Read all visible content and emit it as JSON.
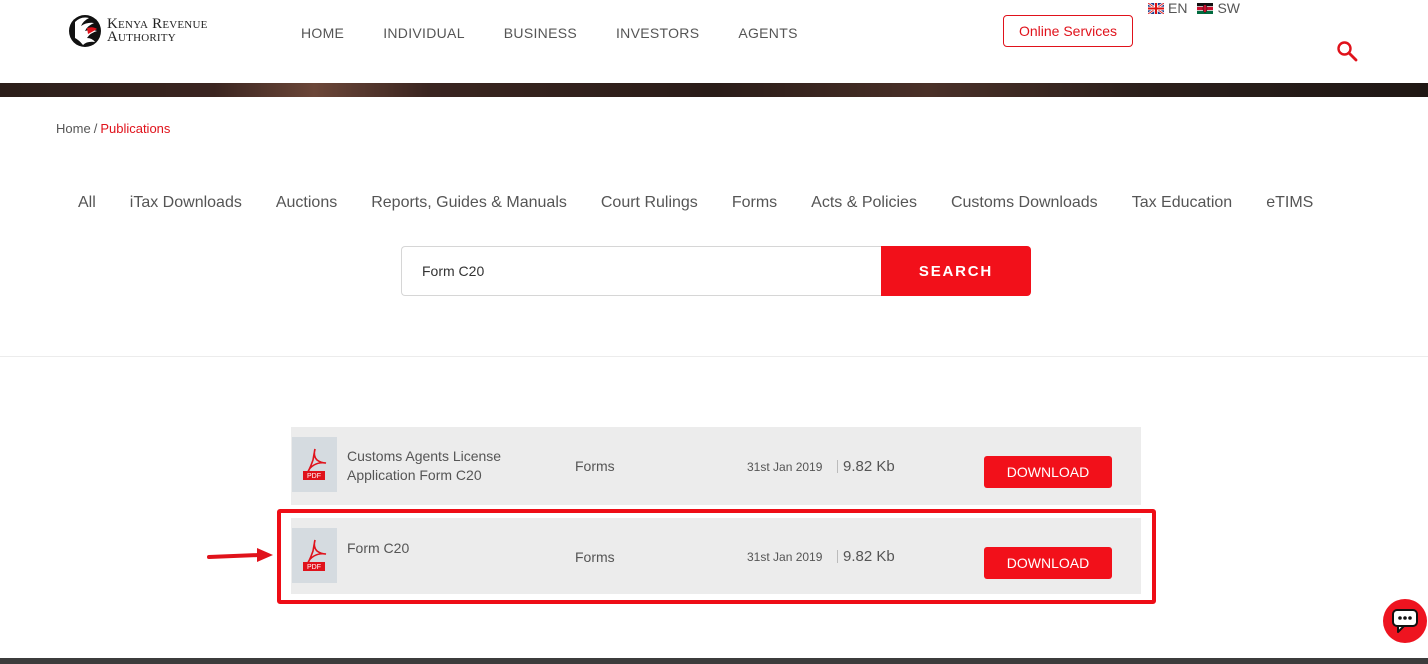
{
  "header": {
    "logo_line1": "Kenya Revenue",
    "logo_line2": "Authority",
    "nav": [
      "HOME",
      "INDIVIDUAL",
      "BUSINESS",
      "INVESTORS",
      "AGENTS"
    ],
    "online_services": "Online Services",
    "languages": [
      {
        "code": "EN",
        "flag": "uk-flag-icon"
      },
      {
        "code": "SW",
        "flag": "kenya-flag-icon"
      }
    ],
    "search_icon": "search-icon"
  },
  "breadcrumb": {
    "home": "Home",
    "separator": "/",
    "current": "Publications"
  },
  "tabs": [
    "All",
    "iTax Downloads",
    "Auctions",
    "Reports, Guides & Manuals",
    "Court Rulings",
    "Forms",
    "Acts & Policies",
    "Customs Downloads",
    "Tax Education",
    "eTIMS"
  ],
  "search": {
    "value": "Form C20",
    "button": "SEARCH"
  },
  "results": [
    {
      "title": "Customs Agents License Application Form C20",
      "category": "Forms",
      "date": "31st Jan 2019",
      "size": "9.82 Kb",
      "button": "DOWNLOAD",
      "icon": "pdf-icon",
      "icon_label": "PDF"
    },
    {
      "title": "Form C20",
      "category": "Forms",
      "date": "31st Jan 2019",
      "size": "9.82 Kb",
      "button": "DOWNLOAD",
      "icon": "pdf-icon",
      "icon_label": "PDF"
    }
  ],
  "colors": {
    "brand_red": "#f2101a",
    "text_gray": "#555555",
    "row_bg": "#ececec"
  },
  "chat_icon": "chat-icon"
}
